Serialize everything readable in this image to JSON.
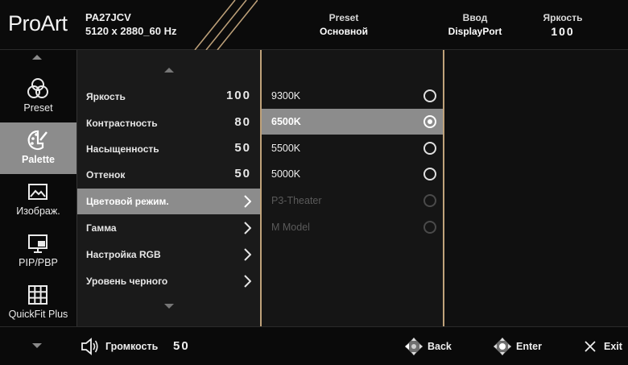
{
  "header": {
    "brand": "ProArt",
    "model": "PA27JCV",
    "resolution": "5120 x 2880_60 Hz",
    "preset_title": "Preset",
    "preset_value": "Основной",
    "input_title": "Ввод",
    "input_value": "DisplayPort",
    "brightness_title": "Яркость",
    "brightness_value": "100"
  },
  "nav": {
    "items": [
      {
        "label": "Preset",
        "icon": "color-circles-icon",
        "active": false
      },
      {
        "label": "Palette",
        "icon": "palette-icon",
        "active": true
      },
      {
        "label": "Изображ.",
        "icon": "image-icon",
        "active": false
      },
      {
        "label": "PIP/PBP",
        "icon": "pip-icon",
        "active": false
      },
      {
        "label": "QuickFit Plus",
        "icon": "grid-icon",
        "active": false
      }
    ]
  },
  "menu": {
    "items": [
      {
        "label": "Яркость",
        "value": "100"
      },
      {
        "label": "Контрастность",
        "value": "80"
      },
      {
        "label": "Насыщенность",
        "value": "50"
      },
      {
        "label": "Оттенок",
        "value": "50"
      },
      {
        "label": "Цветовой режим.",
        "value": null,
        "active": true
      },
      {
        "label": "Гамма",
        "value": null
      },
      {
        "label": "Настройка RGB",
        "value": null
      },
      {
        "label": "Уровень черного",
        "value": null
      }
    ]
  },
  "options": {
    "items": [
      {
        "label": "9300K",
        "selected": false,
        "disabled": false
      },
      {
        "label": "6500K",
        "selected": true,
        "disabled": false
      },
      {
        "label": "5500K",
        "selected": false,
        "disabled": false
      },
      {
        "label": "5000K",
        "selected": false,
        "disabled": false
      },
      {
        "label": "P3-Theater",
        "selected": false,
        "disabled": true
      },
      {
        "label": "M Model",
        "selected": false,
        "disabled": true
      }
    ]
  },
  "footer": {
    "volume_label": "Громкость",
    "volume_value": "50",
    "back_label": "Back",
    "enter_label": "Enter",
    "exit_label": "Exit"
  },
  "colors": {
    "highlight": "#8c8c8c",
    "accent_border": "#bfa27a",
    "background": "#050505"
  }
}
